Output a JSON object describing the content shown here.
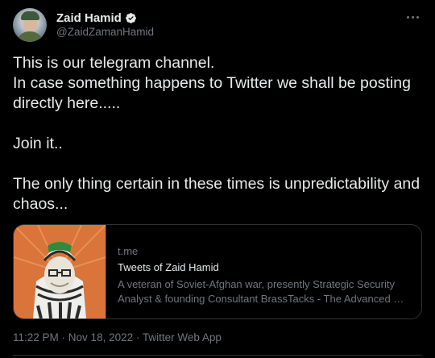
{
  "author": {
    "display_name": "Zaid Hamid",
    "handle": "@ZaidZamanHamid",
    "verified": true
  },
  "tweet": {
    "text": "This is our telegram channel.\nIn case something happens to Twitter we shall be posting directly here.....\n\nJoin it..\n\nThe only thing certain in these times is unpredictability and chaos..."
  },
  "link_card": {
    "domain": "t.me",
    "title": "Tweets of Zaid Hamid",
    "description_line1": "A veteran of Soviet-Afghan war, presently Strategic Security",
    "description_line2": "Analyst & founding Consultant BrassTacks - The Advanced …"
  },
  "meta": {
    "time": "11:22 PM",
    "separator1": " · ",
    "date": "Nov 18, 2022",
    "separator2": " · ",
    "source": "Twitter Web App"
  },
  "icons": {
    "verified": "verified-badge-icon",
    "more": "more-options-icon"
  },
  "colors": {
    "background": "#000000",
    "primary_text": "#e7e9ea",
    "secondary_text": "#71767b",
    "border": "#2f3336",
    "thumb_orange": "#d9743a"
  }
}
